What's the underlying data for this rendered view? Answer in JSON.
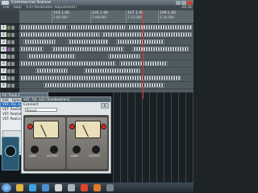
{
  "window": {
    "title": "Commercial licence",
    "menu_right": "24.1k"
  },
  "menu": [
    "File",
    "Help",
    "[FX] Parameter Adjustment]"
  ],
  "ruler": {
    "marks": [
      {
        "top": "103.1.00",
        "bottom": "2:06.000"
      },
      {
        "top": "105.1.00",
        "bottom": "2:08.000"
      },
      {
        "top": "107.1.00",
        "bottom": "2:13.000"
      },
      {
        "top": "109.1.00",
        "bottom": "2:16.000"
      },
      {
        "top": "111.1.00",
        "bottom": "2:19.000"
      }
    ]
  },
  "tracks": [
    "1",
    "2",
    "3",
    "4",
    "5",
    "6",
    "7",
    "8",
    "9"
  ],
  "fx_window": {
    "title": "FX: Track 1",
    "menu": [
      "Edit",
      "Options"
    ],
    "items": [
      "VST: TSC 333 v",
      "VST: ReaFake",
      "VST: ReaFake",
      "VST: ReaComp"
    ]
  },
  "plugin": {
    "title": "VST: TSC 333 (Toneboosters)",
    "connect_label": "Connect",
    "preset": "Preset",
    "close": "X",
    "units": [
      {
        "label_in": "GAIN",
        "label_out": "OUTPUT"
      },
      {
        "label_in": "GAIN",
        "label_out": "OUTPUT"
      }
    ]
  },
  "colors": {
    "cursor": "#d33a2f",
    "accent_red": "#cf2a24",
    "selected": "#2f6fc0"
  },
  "taskbar_icons": [
    "explorer-icon",
    "skype-icon",
    "ie-icon",
    "media-icon",
    "reaper-icon",
    "chrome-icon",
    "firefox-icon",
    "disc-icon"
  ]
}
